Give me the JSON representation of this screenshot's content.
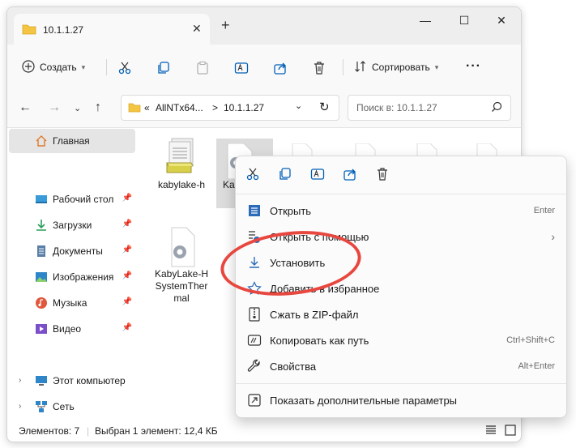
{
  "window": {
    "tab_title": "10.1.1.27",
    "new_tab": "+",
    "close_tab": "✕",
    "minimize": "—",
    "maximize": "☐",
    "close": "✕"
  },
  "toolbar": {
    "create_label": "Создать",
    "sort_label": "Сортировать",
    "more_label": "···"
  },
  "address": {
    "overflow": "«",
    "segment_1": "AllNTx64...",
    "separator": ">",
    "segment_2": "10.1.1.27",
    "search_placeholder": "Поиск в: 10.1.1.27"
  },
  "sidebar": {
    "items": [
      {
        "label": "Главная"
      },
      {
        "label": "Рабочий стол"
      },
      {
        "label": "Загрузки"
      },
      {
        "label": "Документы"
      },
      {
        "label": "Изображения"
      },
      {
        "label": "Музыка"
      },
      {
        "label": "Видео"
      },
      {
        "label": "Этот компьютер"
      },
      {
        "label": "Сеть"
      }
    ]
  },
  "files": [
    {
      "name": "kabylake-h"
    },
    {
      "name": "Kaby HSy"
    },
    {
      "name": "KabyLake-HSystemThermal"
    }
  ],
  "status": {
    "count": "Элементов: 7",
    "selection": "Выбран 1 элемент: 12,4 КБ"
  },
  "context_menu": {
    "items": [
      {
        "label": "Открыть",
        "accel": "Enter"
      },
      {
        "label": "Открыть с помощью",
        "accel": "›"
      },
      {
        "label": "Установить",
        "accel": ""
      },
      {
        "label": "Добавить в избранное",
        "accel": ""
      },
      {
        "label": "Сжать в ZIP-файл",
        "accel": ""
      },
      {
        "label": "Копировать как путь",
        "accel": "Ctrl+Shift+C"
      },
      {
        "label": "Свойства",
        "accel": "Alt+Enter"
      },
      {
        "label": "Показать дополнительные параметры",
        "accel": ""
      }
    ]
  },
  "colors": {
    "accent": "#005fb8",
    "highlight_ring": "#e8473f",
    "folder": "#f4c542"
  }
}
